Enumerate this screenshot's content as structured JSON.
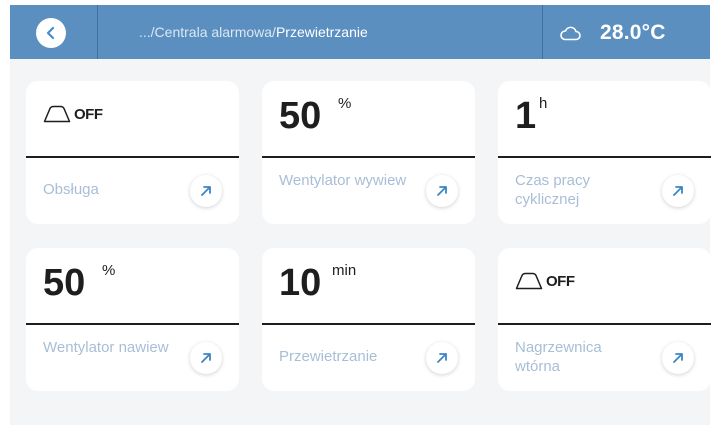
{
  "header": {
    "breadcrumb_path": ".../Centrala alarmowa/",
    "breadcrumb_current": "Przewietrzanie",
    "weather_icon": "cloud-icon",
    "temperature": "28.0°C"
  },
  "tiles": [
    {
      "type": "state",
      "state": "OFF",
      "label": "Obsługa"
    },
    {
      "type": "value",
      "value": "50",
      "unit": "%",
      "label": "Wentylator wywiew"
    },
    {
      "type": "value",
      "value": "1",
      "unit": "h",
      "label": "Czas pracy cyklicznej"
    },
    {
      "type": "value",
      "value": "50",
      "unit": "%",
      "label": "Wentylator nawiew"
    },
    {
      "type": "value",
      "value": "10",
      "unit": "min",
      "label": "Przewietrzanie"
    },
    {
      "type": "state",
      "state": "OFF",
      "label": "Nagrzewnica wtórna"
    }
  ],
  "colors": {
    "header_bg": "#5b8fc0",
    "accent": "#3d84c4",
    "label": "#a8bed6",
    "tile_bg": "#ffffff",
    "screen_bg": "#f4f5f7"
  }
}
